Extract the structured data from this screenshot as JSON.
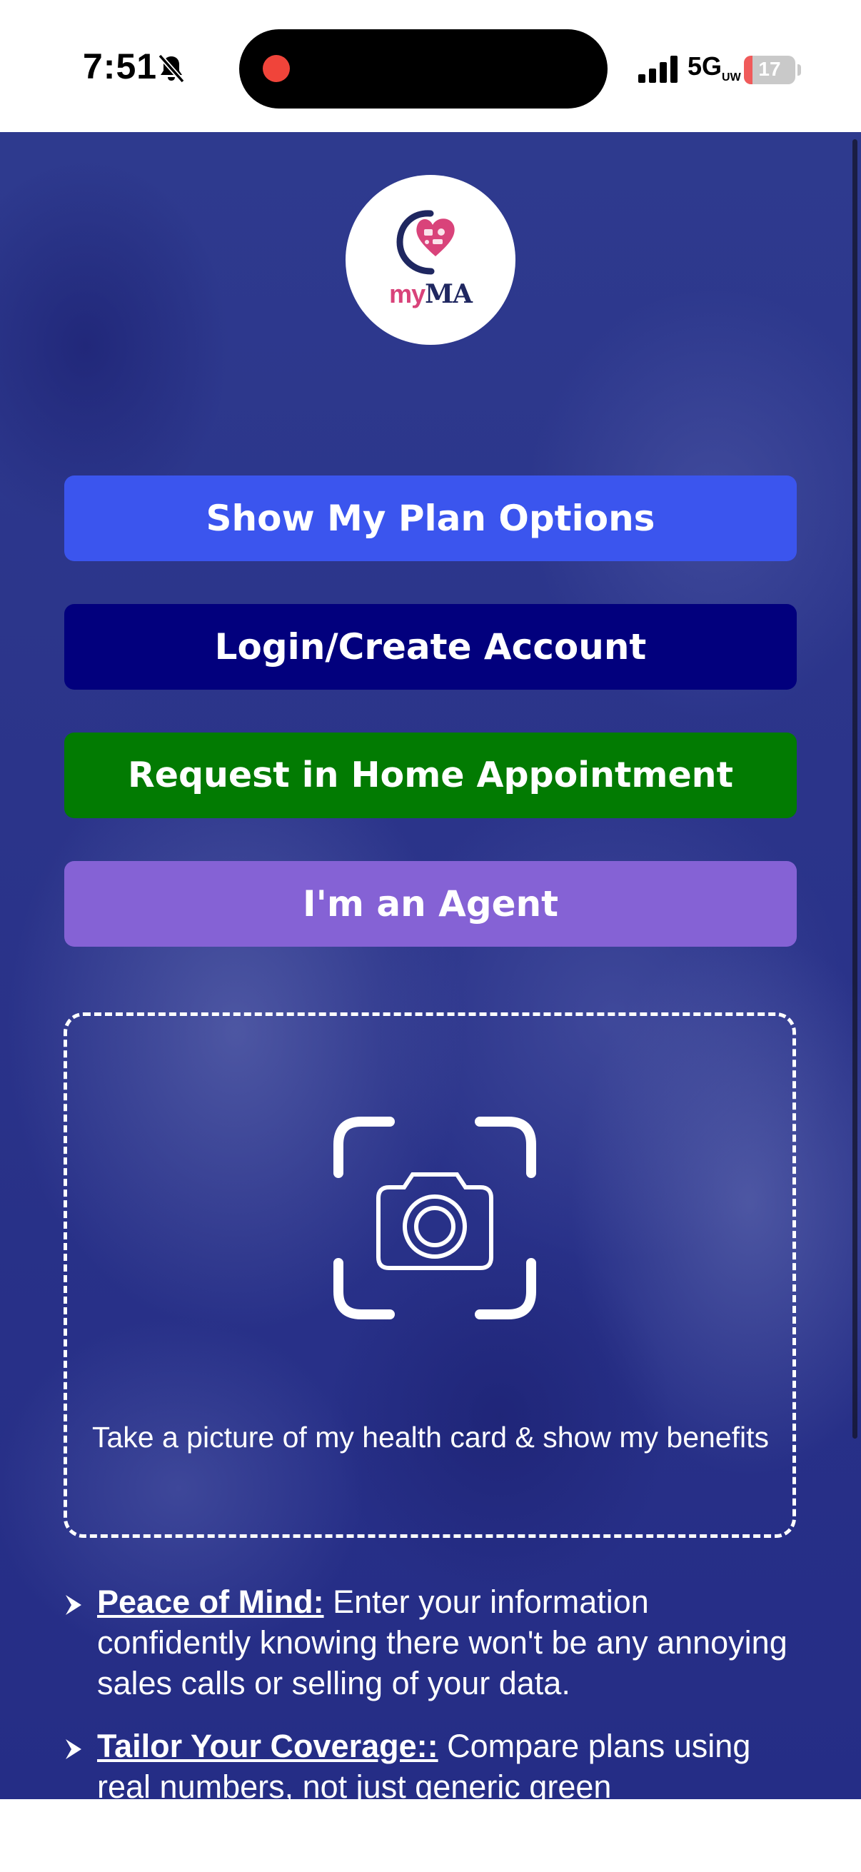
{
  "status_bar": {
    "time": "7:51",
    "network": "5G",
    "network_suffix": "UW",
    "battery_level": "17",
    "battery_fraction": 0.17,
    "silent_icon": "bell-slash-icon",
    "signal_icon": "cellular-signal-icon"
  },
  "header": {
    "logo_my": "my",
    "logo_ma": "MA",
    "logo_icon": "hand-heart-logo-icon"
  },
  "actions": {
    "plan_options": "Show My Plan Options",
    "login": "Login/Create Account",
    "home_appointment": "Request in Home Appointment",
    "agent": "I'm an Agent"
  },
  "upload": {
    "icon": "camera-scan-icon",
    "text": "Take a picture of my health card & show my benefits"
  },
  "features": [
    {
      "title": "Peace of Mind:",
      "body": " Enter your information confidently knowing there won't be any annoying sales calls or selling of your data."
    },
    {
      "title": "Tailor Your Coverage::",
      "body": " Compare plans using real numbers, not just generic green"
    }
  ],
  "colors": {
    "background": "#2b348a",
    "plan_button": "#3b55ee",
    "login_button": "#02007d",
    "home_button": "#027b02",
    "agent_button": "#8562d5",
    "logo_pink": "#d9437a",
    "logo_navy": "#1f2760"
  }
}
